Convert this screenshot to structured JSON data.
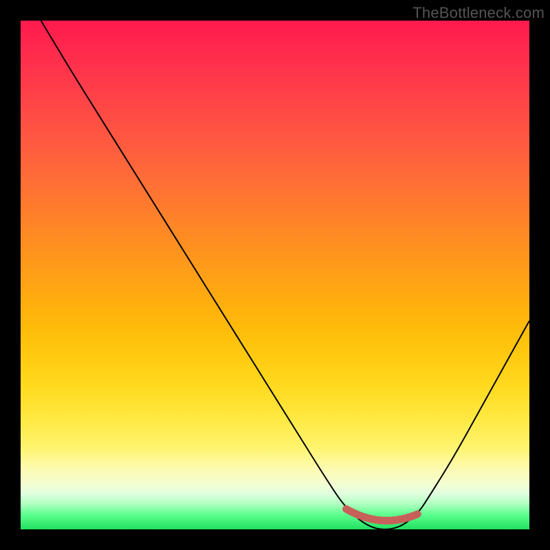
{
  "watermark": "TheBottleneck.com",
  "chart_data": {
    "type": "line",
    "title": "",
    "xlabel": "",
    "ylabel": "",
    "xlim": [
      0,
      100
    ],
    "ylim": [
      0,
      100
    ],
    "series": [
      {
        "name": "bottleneck-curve",
        "x": [
          4,
          10,
          15,
          20,
          25,
          30,
          35,
          40,
          45,
          50,
          55,
          60,
          64,
          69,
          74,
          78,
          80,
          85,
          90,
          95,
          100
        ],
        "y": [
          100,
          90,
          82,
          74,
          66,
          58,
          50,
          42,
          34,
          26,
          18,
          10,
          4,
          0,
          0,
          3,
          6,
          14,
          23,
          32,
          41
        ]
      }
    ],
    "highlight": {
      "name": "optimal-range",
      "color": "#c8605a",
      "x_start": 64,
      "x_end": 78
    },
    "gradient_stops": [
      {
        "pos": 0,
        "color": "#ff1a4d"
      },
      {
        "pos": 50,
        "color": "#ffaa10"
      },
      {
        "pos": 85,
        "color": "#fff470"
      },
      {
        "pos": 100,
        "color": "#20e060"
      }
    ]
  }
}
